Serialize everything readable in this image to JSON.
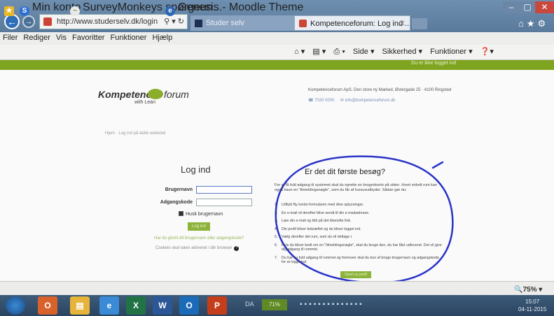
{
  "browser": {
    "address": "http://www.studerselv.dk/login",
    "tabs": [
      "Studer selv",
      "Kompetenceforum: Log ind ...",
      ""
    ],
    "window_controls": {
      "minimize": "–",
      "maximize": "▢",
      "close": "✕"
    }
  },
  "menu": [
    "Filer",
    "Rediger",
    "Vis",
    "Favoritter",
    "Funktioner",
    "Hjælp"
  ],
  "favorites": [
    "Min konto",
    "SurveyMonkeys spørgeun...",
    "Genesis - Moodle Theme"
  ],
  "command_bar": [
    "Side ▾",
    "Sikkerhed ▾",
    "Funktioner ▾"
  ],
  "site": {
    "logo_left": "Kompetence",
    "logo_right": "forum",
    "logo_tag": "with Lean",
    "top_notice": "Du er ikke logget ind",
    "address_line": "Kompetenceforum ApS, Den store ny Marked, Østergade 25 · 4100 Ringsted",
    "phone": "7020 0000",
    "email": "info@kompetenceforum.dk",
    "breadcrumb": "Hjem · Log ind på dette websted"
  },
  "login": {
    "title": "Log ind",
    "username_label": "Brugernavn",
    "password_label": "Adgangskode",
    "username_value": "",
    "remember_label": "Husk brugernavn",
    "login_button": "Log ind",
    "forgot_link": "Har du glemt dit brugernavn eller adgangskode?",
    "cookies_note": "Cookies skal være aktiveret i din browser"
  },
  "first_visit": {
    "title": "Er det dit første besøg?",
    "intro": "For at få fuld adgang til systemet skal du oprette en brugerkonto på siden. Hvert enkelt rum kan også have en \"tilmeldingsnøgle\", som du får af kursusudbyder. Sådan gør du:",
    "steps": [
      {
        "n": "1.",
        "text": "Udfyld Ny konto-formularen med dine oplysninger."
      },
      {
        "n": "2.",
        "text": "En e-mail vil derefter blive sendt til din e-mailadresse."
      },
      {
        "n": "3.",
        "text": "Læs din e-mail og klik på det tilsendte link."
      },
      {
        "n": "4.",
        "text": "Din profil bliver bekræftet og du bliver logget ind."
      },
      {
        "n": "5.",
        "text": "Vælg derefter det rum, som du vil deltage i."
      },
      {
        "n": "6.",
        "text": "Hvis du bliver bedt om en \"tilmeldingsnøgle\", skal du bruge den, du har fået udleveret. Det vil give dig adgang til rummet."
      },
      {
        "n": "7.",
        "text": "Du har nu fuld adgang til rummet og fremover skal du kun af bruge brugernavn og adgangskode for at logge ind."
      }
    ],
    "create_button": "Opret ny profil"
  },
  "status": {
    "zoom": "75%"
  },
  "taskbar": {
    "language": "DA",
    "battery": "71%",
    "time": "15:07",
    "date": "04-11-2015"
  },
  "colors": {
    "accent_green": "#8db43a",
    "ink_circle": "#2a33c8"
  }
}
